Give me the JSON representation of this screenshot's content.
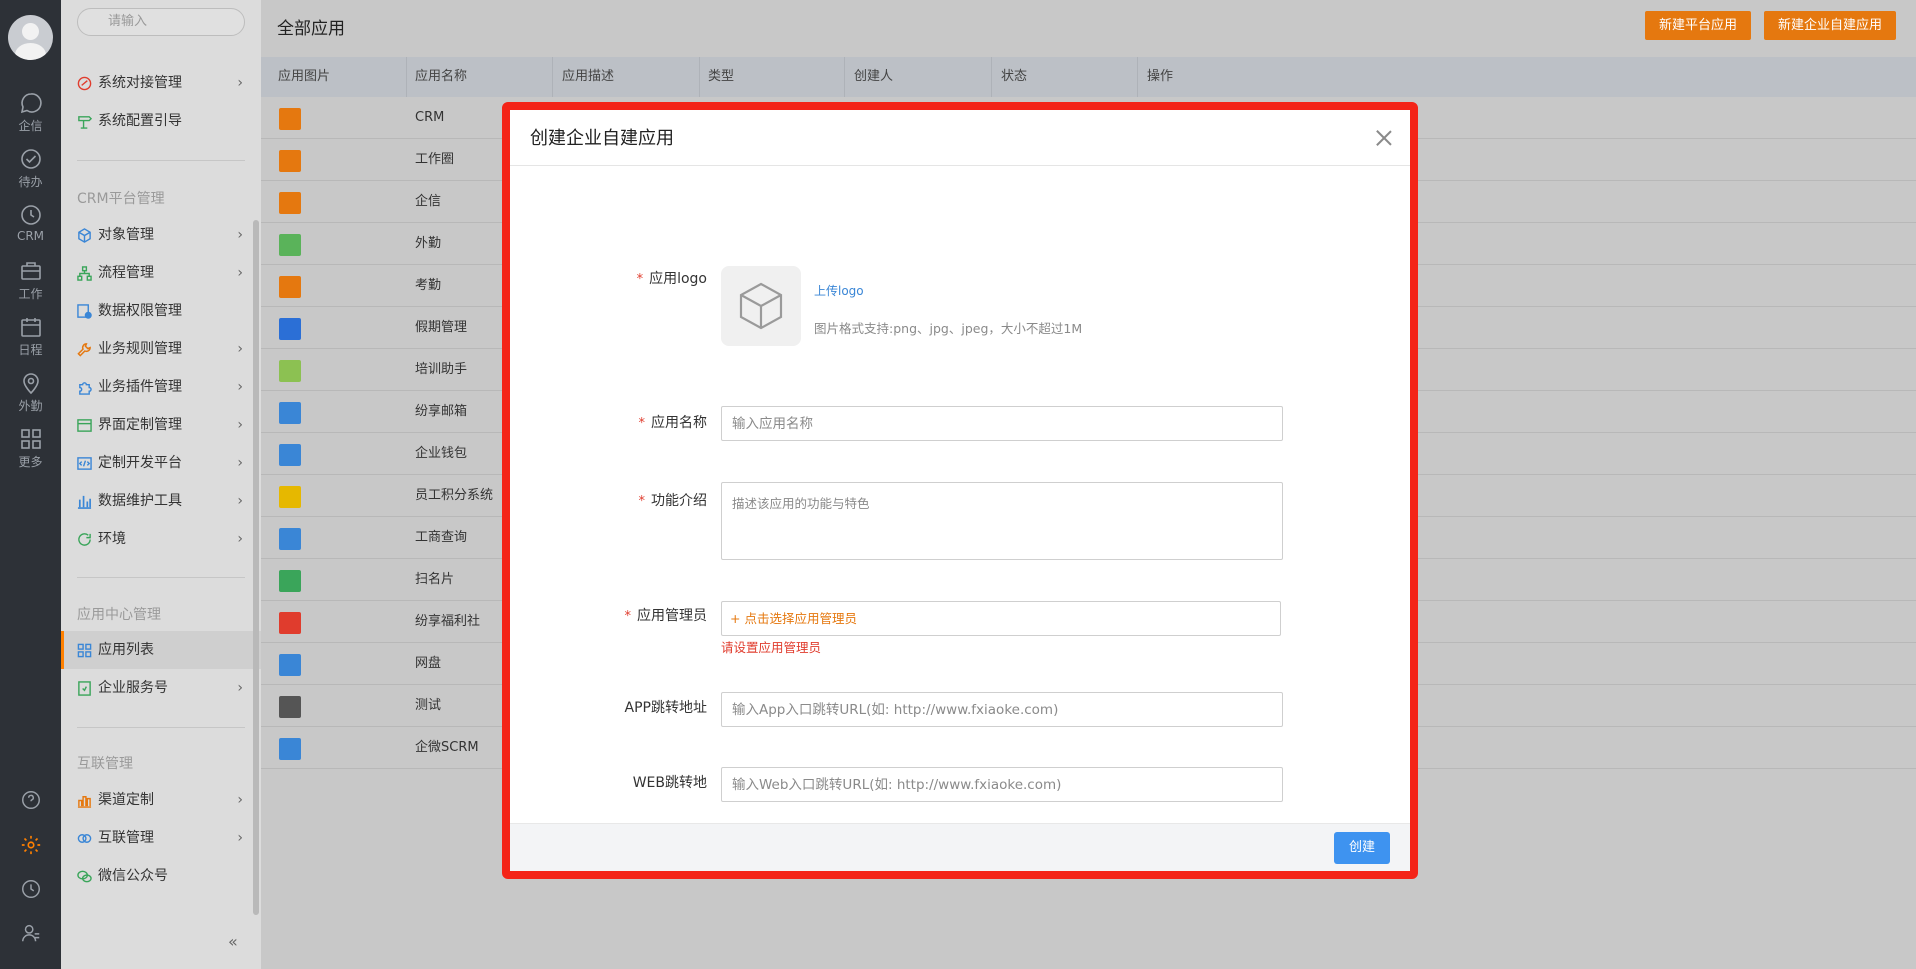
{
  "rail": {
    "items": [
      {
        "label": "企信",
        "icon": "chat-bubble-icon"
      },
      {
        "label": "待办",
        "icon": "check-circle-icon"
      },
      {
        "label": "CRM",
        "icon": "clock-icon"
      },
      {
        "label": "工作",
        "icon": "briefcase-icon"
      },
      {
        "label": "日程",
        "icon": "calendar-icon"
      },
      {
        "label": "外勤",
        "icon": "location-pin-icon"
      },
      {
        "label": "更多",
        "icon": "grid-icon"
      }
    ],
    "active_color": "#ff8000"
  },
  "sidebar": {
    "search_placeholder": "请输入",
    "items_top": [
      {
        "label": "系统对接管理",
        "icon": "link-icon",
        "color": "#e03c2d"
      },
      {
        "label": "系统配置引导",
        "icon": "signpost-icon",
        "color": "#3aa55a"
      }
    ],
    "section_crm": "CRM平台管理",
    "items_crm": [
      {
        "label": "对象管理",
        "icon": "cube-icon",
        "color": "#3a86d6"
      },
      {
        "label": "流程管理",
        "icon": "flow-icon",
        "color": "#3aa55a"
      },
      {
        "label": "数据权限管理",
        "icon": "data-lock-icon",
        "color": "#3a86d6"
      },
      {
        "label": "业务规则管理",
        "icon": "wrench-icon",
        "color": "#e5780f"
      },
      {
        "label": "业务插件管理",
        "icon": "puzzle-icon",
        "color": "#3a86d6"
      },
      {
        "label": "界面定制管理",
        "icon": "window-icon",
        "color": "#3aa55a"
      },
      {
        "label": "定制开发平台",
        "icon": "code-icon",
        "color": "#3a86d6"
      },
      {
        "label": "数据维护工具",
        "icon": "bar-chart-icon",
        "color": "#3a86d6"
      },
      {
        "label": "环境",
        "icon": "refresh-icon",
        "color": "#3aa55a"
      }
    ],
    "section_app": "应用中心管理",
    "items_app": [
      {
        "label": "应用列表",
        "icon": "app-grid-icon",
        "color": "#3a86d6"
      },
      {
        "label": "企业服务号",
        "icon": "service-icon",
        "color": "#3aa55a"
      }
    ],
    "section_link": "互联管理",
    "items_link": [
      {
        "label": "渠道定制",
        "icon": "channel-icon",
        "color": "#e5780f"
      },
      {
        "label": "互联管理",
        "icon": "interconnect-icon",
        "color": "#3a86d6"
      },
      {
        "label": "微信公众号",
        "icon": "wechat-icon",
        "color": "#3aa55a"
      }
    ],
    "chevron": "›",
    "collapse_glyph": "«"
  },
  "main": {
    "title": "全部应用",
    "btn_platform": "新建平台应用",
    "btn_enterprise": "新建企业自建应用",
    "columns": [
      "应用图片",
      "应用名称",
      "应用描述",
      "类型",
      "创建人",
      "状态",
      "操作"
    ],
    "rows": [
      {
        "name": "CRM",
        "color": "#e5780f"
      },
      {
        "name": "工作圈",
        "color": "#e5780f"
      },
      {
        "name": "企信",
        "color": "#e5780f"
      },
      {
        "name": "外勤",
        "color": "#5ab35a"
      },
      {
        "name": "考勤",
        "color": "#e5780f"
      },
      {
        "name": "假期管理",
        "color": "#2b6fd6"
      },
      {
        "name": "培训助手",
        "color": "#8cc152"
      },
      {
        "name": "纷享邮箱",
        "color": "#3a86d6"
      },
      {
        "name": "企业钱包",
        "color": "#3a86d6"
      },
      {
        "name": "员工积分系统",
        "color": "#e6b800"
      },
      {
        "name": "工商查询",
        "color": "#3a86d6"
      },
      {
        "name": "扫名片",
        "color": "#3aa55a"
      },
      {
        "name": "纷享福利社",
        "color": "#e03c2d"
      },
      {
        "name": "网盘",
        "color": "#3a86d6"
      },
      {
        "name": "测试",
        "color": "#555555"
      },
      {
        "name": "企微SCRM",
        "color": "#3a86d6"
      }
    ]
  },
  "modal": {
    "title": "创建企业自建应用",
    "required_mark": "*",
    "logo_label": "应用logo",
    "logo_link": "上传logo",
    "logo_hint": "图片格式支持:png、jpg、jpeg，大小不超过1M",
    "name_label": "应用名称",
    "name_placeholder": "输入应用名称",
    "desc_label": "功能介绍",
    "desc_placeholder": "描述该应用的功能与特色",
    "admin_label": "应用管理员",
    "admin_selector": "+ 点击选择应用管理员",
    "admin_error": "请设置应用管理员",
    "app_url_label": "APP跳转地址",
    "app_url_placeholder": "输入App入口跳转URL(如: http://www.fxiaoke.com)",
    "web_url_label": "WEB跳转地",
    "web_url_placeholder": "输入Web入口跳转URL(如: http://www.fxiaoke.com)",
    "create_btn": "创建",
    "highlight_color": "#f42418"
  }
}
